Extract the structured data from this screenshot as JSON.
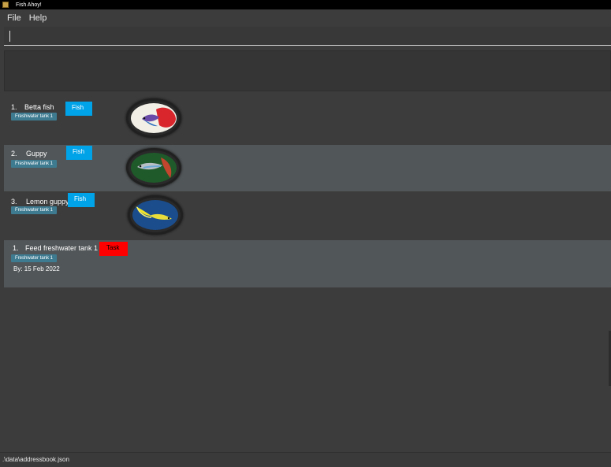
{
  "window": {
    "title": "Fish Ahoy!"
  },
  "menu": {
    "items": [
      "File",
      "Help"
    ]
  },
  "command": {
    "value": ""
  },
  "fish": [
    {
      "index": "1.",
      "name": "Betta fish",
      "type": "Fish",
      "tag": "Freshwater tank 1",
      "photo": "betta-fish-photo"
    },
    {
      "index": "2.",
      "name": "Guppy",
      "type": "Fish",
      "tag": "Freshwater tank 1",
      "photo": "guppy-photo"
    },
    {
      "index": "3.",
      "name": "Lemon guppy",
      "type": "Fish",
      "tag": "Freshwater tank 1",
      "photo": "lemon-guppy-photo"
    }
  ],
  "tasks": [
    {
      "index": "1.",
      "name": "Feed freshwater tank 1",
      "type": "Task",
      "tag": "Freshwater tank 1",
      "due": "By: 15 Feb 2022"
    }
  ],
  "status": {
    "path": ".\\data\\addressbook.json"
  },
  "colors": {
    "background": "#3c3c3c",
    "row_alt": "#515658",
    "tag": "#3e7b91",
    "fish_badge": "#00a2e8",
    "task_badge": "#ff0000"
  }
}
